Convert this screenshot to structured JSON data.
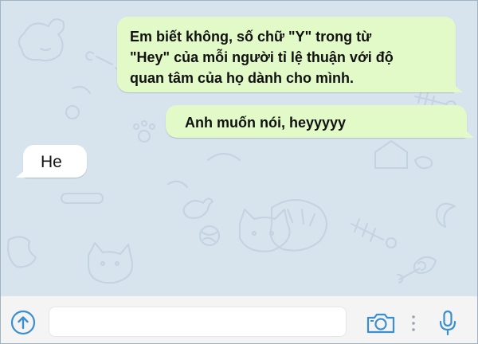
{
  "messages": [
    {
      "direction": "outgoing",
      "lines": [
        "Em biết không, số chữ \"Y\" trong từ",
        "\"Hey\" của mỗi người tỉ lệ thuận với độ",
        "quan tâm của họ dành cho mình."
      ]
    },
    {
      "direction": "outgoing",
      "text": "Anh muốn nói, heyyyyy"
    },
    {
      "direction": "incoming",
      "text": "He"
    }
  ],
  "composer": {
    "message_value": "",
    "icons": {
      "attach": "arrow-up-circle-icon",
      "camera": "camera-icon",
      "menu": "vertical-dots-icon",
      "mic": "microphone-icon"
    }
  },
  "colors": {
    "chat_background": "#d7e3ed",
    "outgoing_bubble": "#e2fac8",
    "incoming_bubble": "#ffffff",
    "accent_blue": "#3a8fd0",
    "input_bar": "#f4f4f4"
  }
}
